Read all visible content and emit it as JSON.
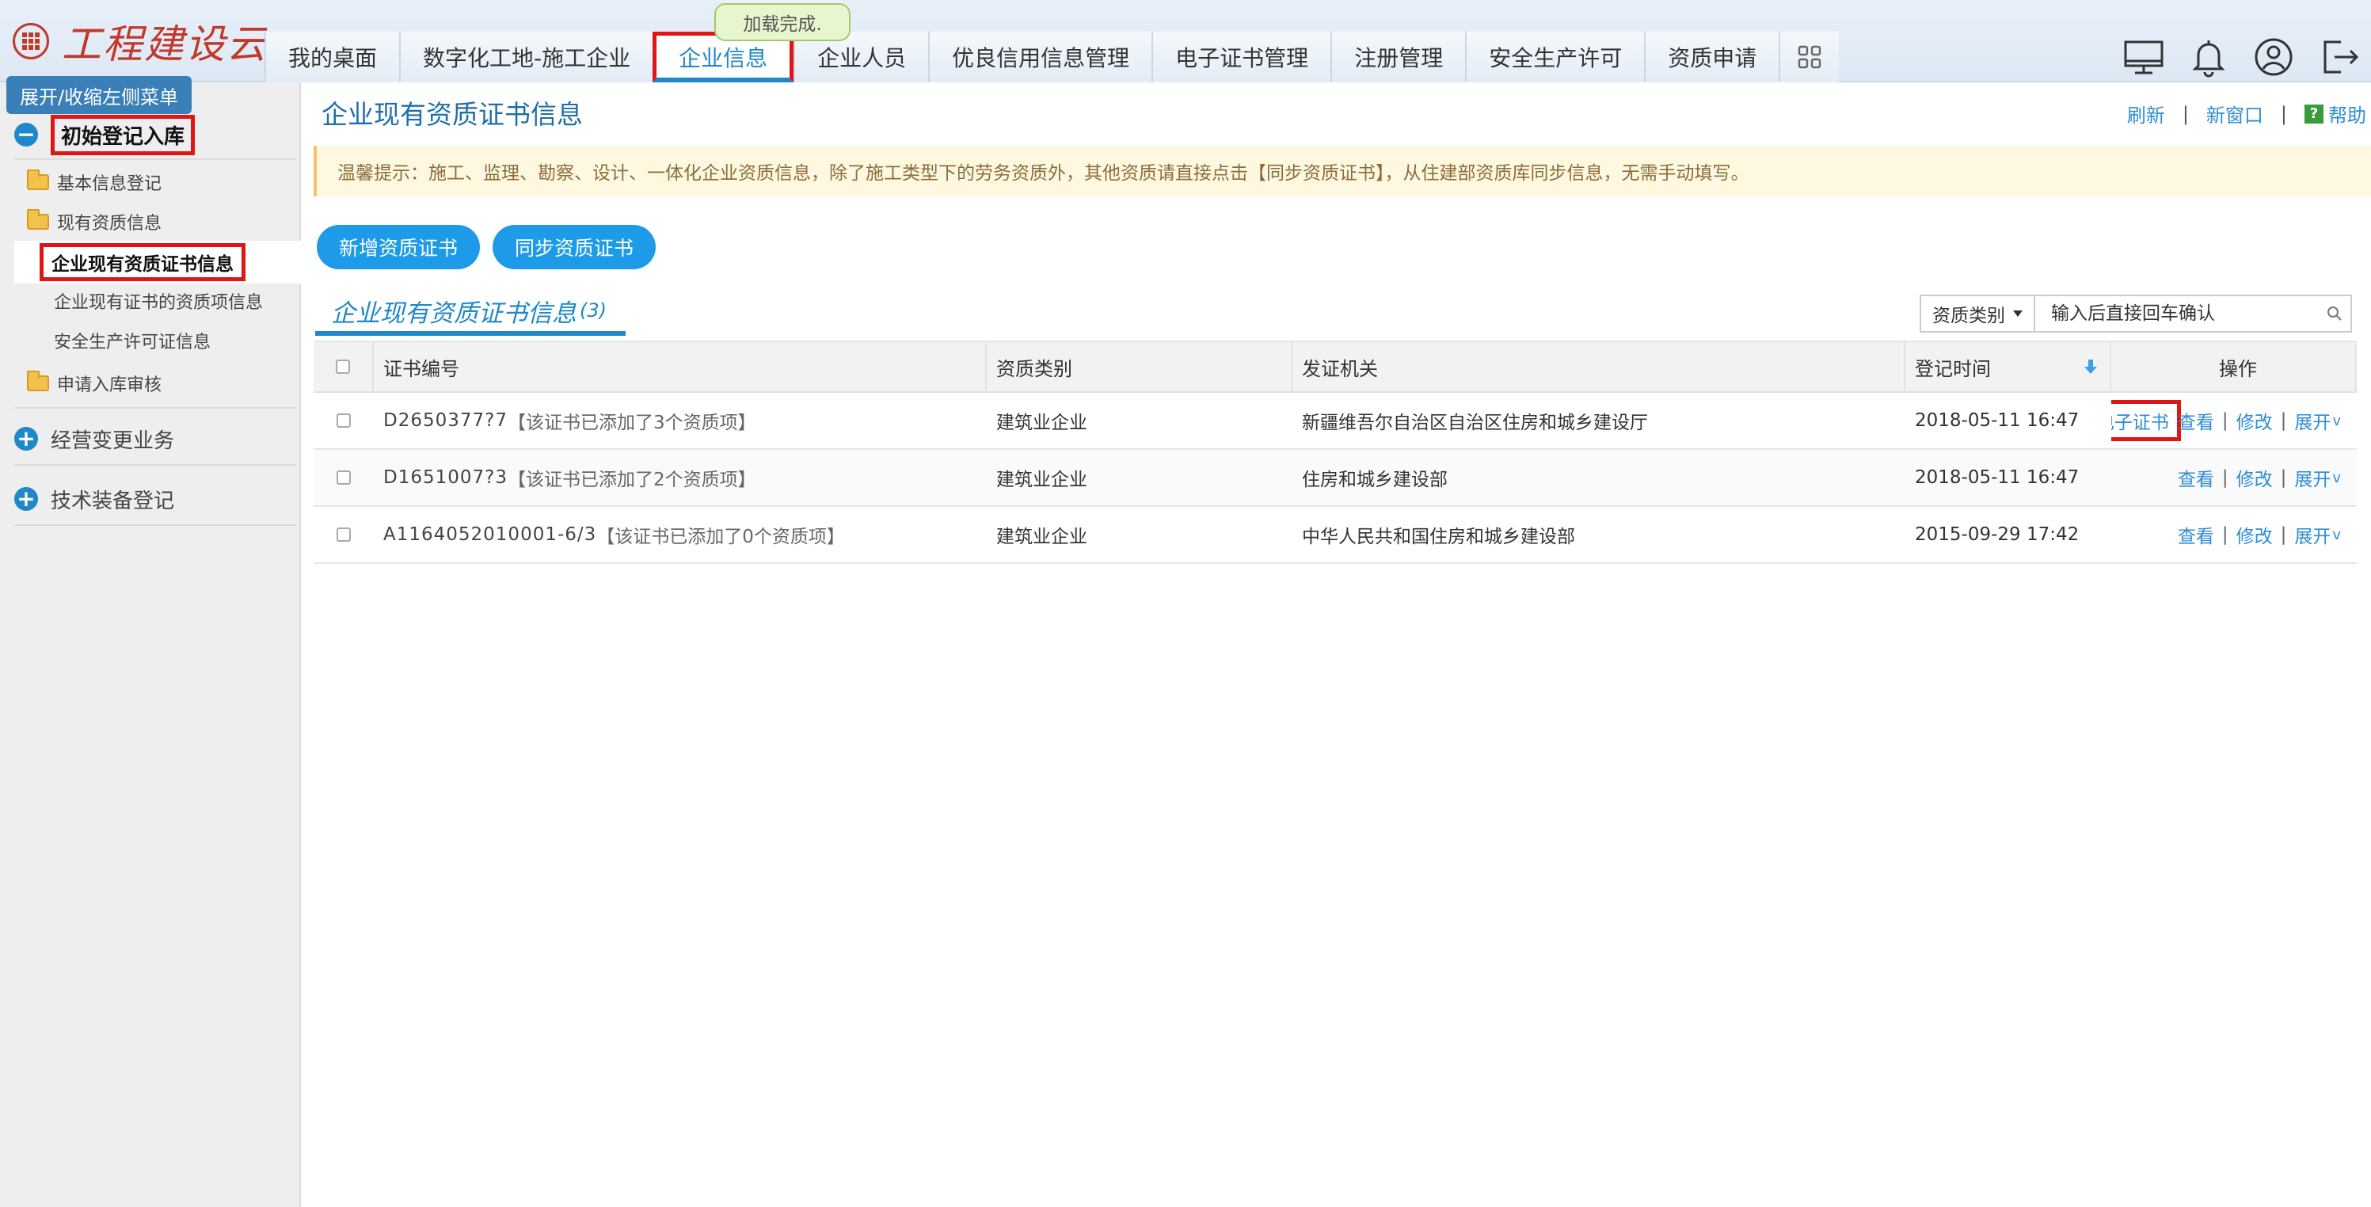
{
  "app": {
    "logo_text": "工程建设云",
    "loading_text": "加载完成."
  },
  "nav": {
    "tabs": [
      {
        "label": "我的桌面"
      },
      {
        "label": "数字化工地-施工企业"
      },
      {
        "label": "企业信息"
      },
      {
        "label": "企业人员"
      },
      {
        "label": "优良信用信息管理"
      },
      {
        "label": "电子证书管理"
      },
      {
        "label": "注册管理"
      },
      {
        "label": "安全生产许可"
      },
      {
        "label": "资质申请"
      }
    ],
    "active_tab": "企业信息"
  },
  "header_icons": [
    "monitor-icon",
    "bell-icon",
    "user-icon",
    "logout-icon"
  ],
  "sidebar": {
    "toggle_tip": "展开/收缩左侧菜单",
    "section_main": "初始登记入库",
    "items": [
      {
        "label": "基本信息登记"
      },
      {
        "label": "现有资质信息"
      },
      {
        "label": "企业现有资质证书信息"
      },
      {
        "label": "企业现有证书的资质项信息"
      },
      {
        "label": "安全生产许可证信息"
      },
      {
        "label": "申请入库审核"
      }
    ],
    "section_business": "经营变更业务",
    "section_equipment": "技术装备登记"
  },
  "main": {
    "title": "企业现有资质证书信息",
    "links": {
      "refresh": "刷新",
      "new_window": "新窗口",
      "help": "帮助"
    },
    "tip": "温馨提示：施工、监理、勘察、设计、一体化企业资质信息，除了施工类型下的劳务资质外，其他资质请直接点击【同步资质证书】，从住建部资质库同步信息，无需手动填写。",
    "buttons": {
      "add": "新增资质证书",
      "sync": "同步资质证书"
    },
    "list_tab": {
      "label": "企业现有资质证书信息",
      "count": "(3)"
    },
    "filter": {
      "category": "资质类别",
      "placeholder": "输入后直接回车确认"
    },
    "table": {
      "headers": {
        "cert_no": "证书编号",
        "category": "资质类别",
        "issuer": "发证机关",
        "reg_time": "登记时间",
        "ops": "操作"
      },
      "rows": [
        {
          "cert_no": "D2650377?7",
          "note": "【该证书已添加了3个资质项】",
          "category": "建筑业企业",
          "issuer": "新疆维吾尔自治区自治区住房和城乡建设厅",
          "reg_time": "2018-05-11 16:47",
          "download": "下载电子证书",
          "view": "查看",
          "edit": "修改",
          "expand": "展开"
        },
        {
          "cert_no": "D1651007?3",
          "note": "【该证书已添加了2个资质项】",
          "category": "建筑业企业",
          "issuer": "住房和城乡建设部",
          "reg_time": "2018-05-11 16:47",
          "view": "查看",
          "edit": "修改",
          "expand": "展开"
        },
        {
          "cert_no": "A1164052010001-6/3",
          "note": "【该证书已添加了0个资质项】",
          "category": "建筑业企业",
          "issuer": "中华人民共和国住房和城乡建设部",
          "reg_time": "2015-09-29 17:42",
          "view": "查看",
          "edit": "修改",
          "expand": "展开"
        }
      ]
    }
  },
  "colors": {
    "accent": "#1e88c9",
    "highlight": "#e01515",
    "button": "#1d9be8",
    "logo": "#c0392b"
  }
}
